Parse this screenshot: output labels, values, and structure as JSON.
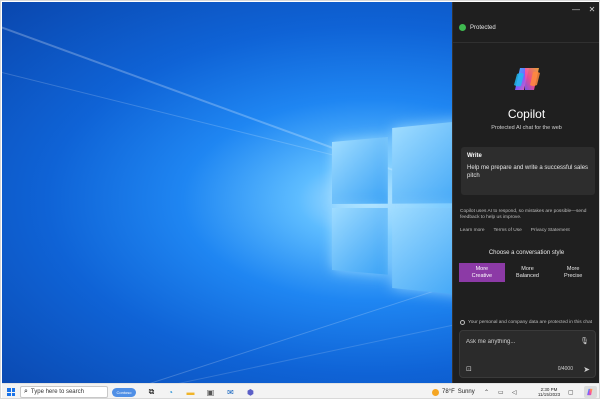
{
  "copilot": {
    "window_controls": {
      "minimize": "—",
      "close": "✕"
    },
    "protected_label": "Protected",
    "title": "Copilot",
    "subtitle": "Protected AI chat for the web",
    "suggestion": {
      "label": "Write",
      "text": "Help me prepare and write a successful sales pitch"
    },
    "disclaimer": "Copilot uses AI to respond, so mistakes are possible—send feedback to help us improve.",
    "links": [
      "Learn more",
      "Terms of Use",
      "Privacy Statement"
    ],
    "style_title": "Choose a conversation style",
    "styles": [
      {
        "line1": "More",
        "line2": "Creative",
        "active": true
      },
      {
        "line1": "More",
        "line2": "Balanced",
        "active": false
      },
      {
        "line1": "More",
        "line2": "Precise",
        "active": false
      }
    ],
    "privacy_note": "Your personal and company data are protected in this chat",
    "composer": {
      "placeholder": "Ask me anything...",
      "counter": "0/4000"
    }
  },
  "taskbar": {
    "search_placeholder": "Type here to search",
    "search_badge": "Contoso",
    "weather": {
      "temp": "78°F",
      "condition": "Sunny"
    },
    "clock": {
      "time": "2:30 PM",
      "date": "11/15/2023"
    },
    "icons": [
      "start-icon",
      "task-view-icon",
      "edge-icon",
      "file-explorer-icon",
      "store-icon",
      "outlook-icon",
      "teams-icon",
      "copilot-icon"
    ]
  },
  "colors": {
    "panel_bg": "#1f1f1f",
    "creative_accent": "#8c3aa6",
    "protected_green": "#3fb950",
    "desktop_blue": "#1f86f2"
  }
}
